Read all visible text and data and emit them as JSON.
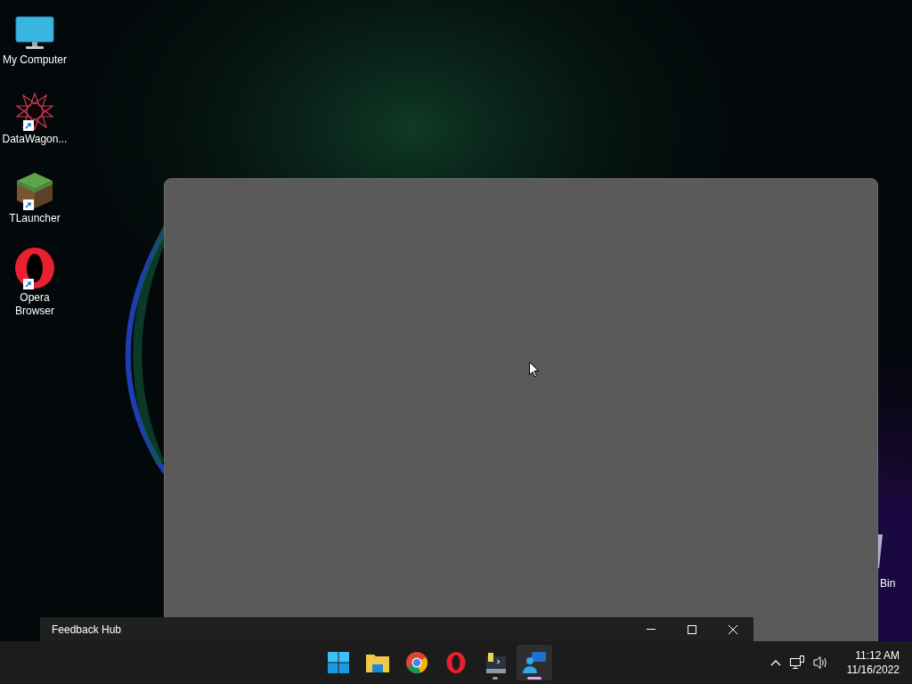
{
  "desktop_icons": [
    {
      "kind": "monitor",
      "label": "My Computer",
      "shortcut": false
    },
    {
      "kind": "star",
      "label": "DataWagon...",
      "shortcut": true
    },
    {
      "kind": "grass",
      "label": "TLauncher",
      "shortcut": true
    },
    {
      "kind": "opera",
      "label": "Opera Browser",
      "shortcut": true
    }
  ],
  "bin_icon": {
    "label": "Bin"
  },
  "window": {
    "title": "Feedback Hub"
  },
  "taskbar": {
    "apps": [
      {
        "kind": "start",
        "running": false,
        "selected": false
      },
      {
        "kind": "folder",
        "running": false,
        "selected": false
      },
      {
        "kind": "chrome",
        "running": false,
        "selected": false
      },
      {
        "kind": "opera",
        "running": false,
        "selected": false
      },
      {
        "kind": "python",
        "running": true,
        "selected": false
      },
      {
        "kind": "feedback",
        "running": true,
        "selected": true
      }
    ],
    "time": "11:12 AM",
    "date": "11/16/2022"
  }
}
